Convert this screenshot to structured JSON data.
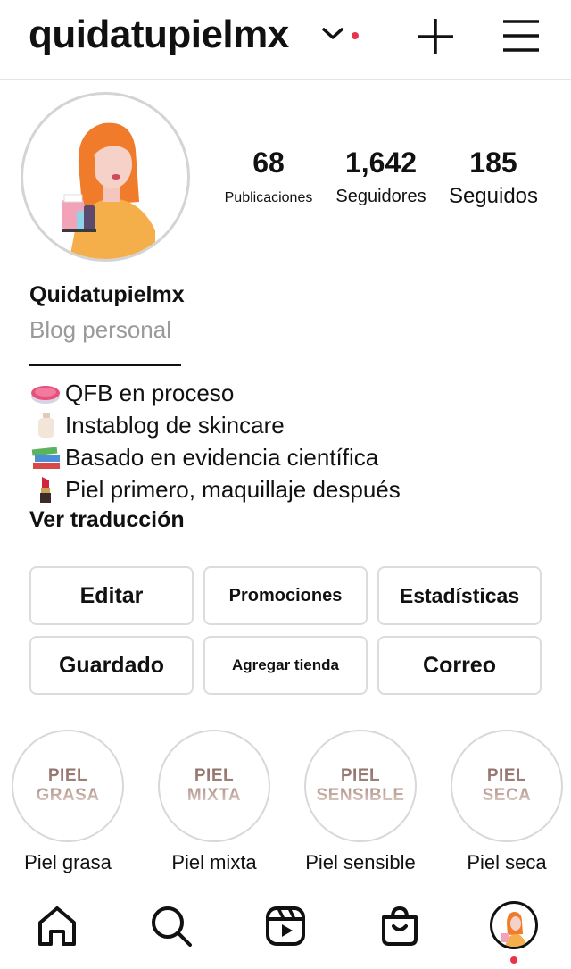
{
  "header": {
    "username": "quidatupielmx",
    "accent": "#e8334a"
  },
  "profile": {
    "stats": [
      {
        "num": "68",
        "label": "Publicaciones"
      },
      {
        "num": "1,642",
        "label": "Seguidores"
      },
      {
        "num": "185",
        "label": "Seguidos"
      }
    ],
    "name": "Quidatupielmx",
    "category": "Blog personal",
    "bio": [
      {
        "icon": "petri-dish-icon",
        "text": "QFB en proceso"
      },
      {
        "icon": "lotion-bottle-icon",
        "text": "Instablog de skincare"
      },
      {
        "icon": "books-icon",
        "text": "Basado en evidencia científica"
      },
      {
        "icon": "lipstick-icon",
        "text": "Piel primero, maquillaje después"
      }
    ],
    "translate": "Ver traducción"
  },
  "buttons": [
    "Editar",
    "Promociones",
    "Estadísticas",
    "Guardado",
    "Agregar tienda",
    "Correo"
  ],
  "highlights": [
    {
      "line1": "PIEL",
      "line2": "GRASA",
      "label": "Piel grasa"
    },
    {
      "line1": "PIEL",
      "line2": "MIXTA",
      "label": "Piel mixta"
    },
    {
      "line1": "PIEL",
      "line2": "SENSIBLE",
      "label": "Piel sensible"
    },
    {
      "line1": "PIEL",
      "line2": "SECA",
      "label": "Piel seca"
    }
  ],
  "nav": [
    "home-icon",
    "search-icon",
    "reels-icon",
    "shop-icon",
    "profile-avatar"
  ]
}
